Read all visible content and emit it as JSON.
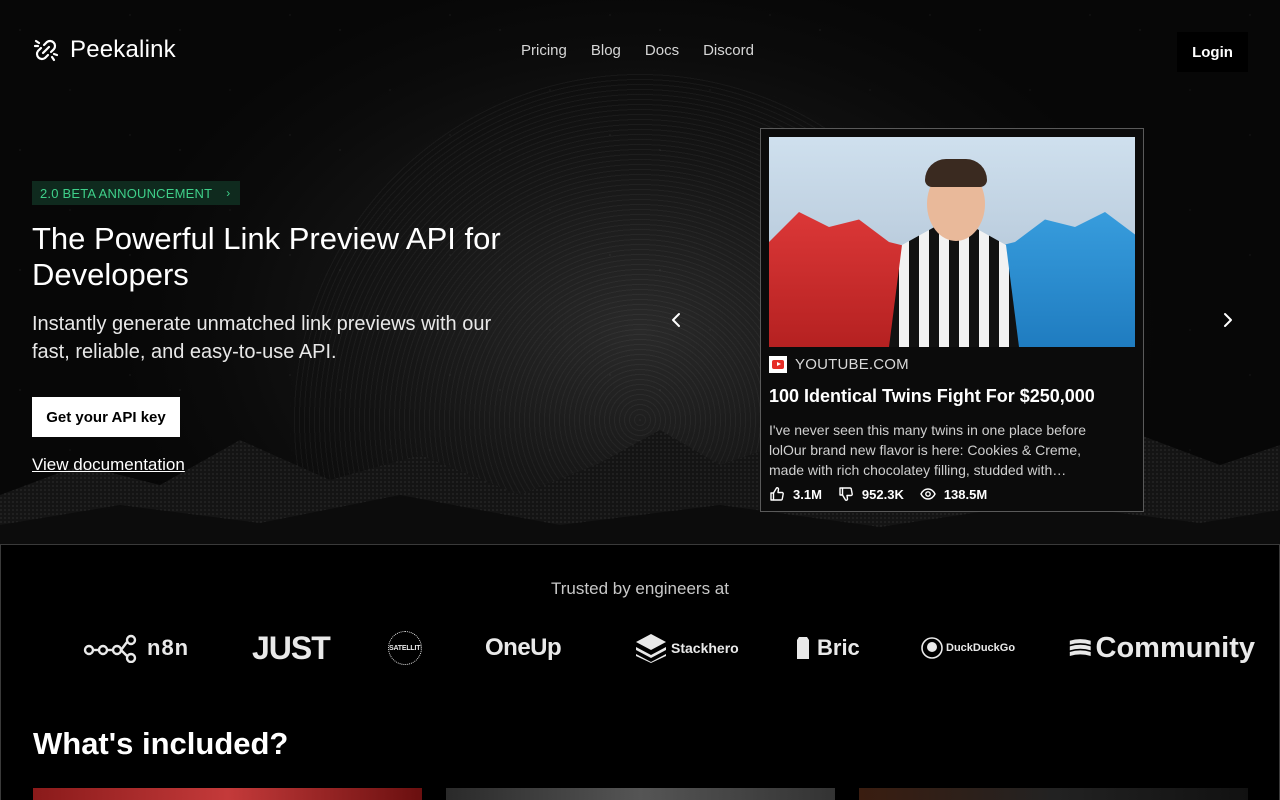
{
  "brand": {
    "name": "Peekalink"
  },
  "nav": {
    "links": [
      "Pricing",
      "Blog",
      "Docs",
      "Discord"
    ],
    "login_label": "Login"
  },
  "hero": {
    "badge": "2.0 BETA ANNOUNCEMENT",
    "headline": "The Powerful Link Preview API for Developers",
    "subhead": "Instantly generate unmatched link previews with our fast, reliable, and easy-to-use API.",
    "cta_label": "Get your API key",
    "doc_link": "View documentation"
  },
  "preview_card": {
    "site": "YOUTUBE.COM",
    "title": "100 Identical Twins Fight For $250,000",
    "description": "I've never seen this many twins in one place before lolOur brand new flavor is here: Cookies & Creme, made with rich chocolatey filling, studded with…",
    "likes": "3.1M",
    "dislikes": "952.3K",
    "views": "138.5M"
  },
  "trusted": {
    "label": "Trusted by engineers at",
    "logos": [
      "n8n",
      "JUST",
      "SATELLITE",
      "OneUp",
      "Stackhero",
      "Bric",
      "DuckDuckGo",
      "Community"
    ]
  },
  "included": {
    "title": "What's included?"
  },
  "colors": {
    "accent_green": "#3fd08a",
    "badge_bg": "#0f2a1e",
    "youtube_red": "#e52d27"
  }
}
